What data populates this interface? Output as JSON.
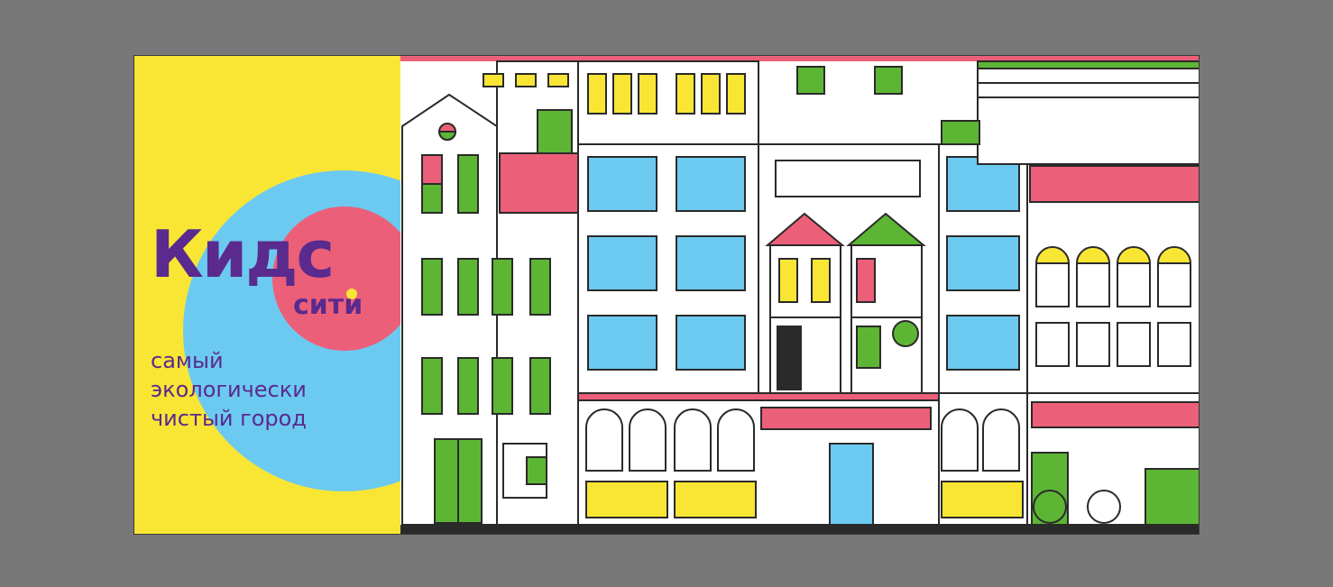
{
  "brand": {
    "logo_main": "Кидс",
    "logo_sub": "сити"
  },
  "tagline": {
    "line1": "самый",
    "line2": "экологически",
    "line3": "чистый город"
  },
  "colors": {
    "background": "#787878",
    "yellow": "#f9e634",
    "blue": "#6ccaf0",
    "pink": "#ec5f79",
    "purple": "#5a2a8e",
    "green": "#5db534",
    "dark": "#2a2a2a"
  }
}
